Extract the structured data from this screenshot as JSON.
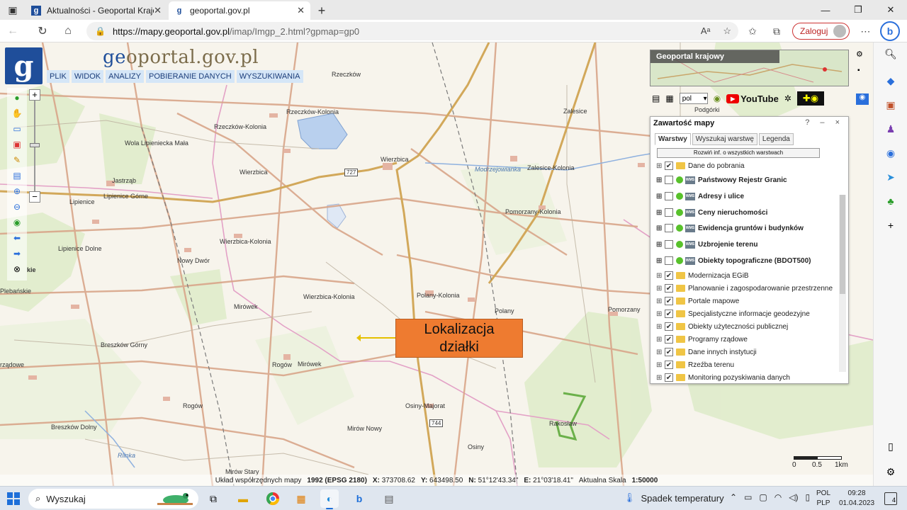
{
  "browser": {
    "tabs": [
      {
        "title": "Aktualności - Geoportal Krajowy",
        "active": false
      },
      {
        "title": "geoportal.gov.pl",
        "active": true
      }
    ],
    "url_host": "https://mapy.geoportal.gov.pl",
    "url_path": "/imap/Imgp_2.html?gpmap=gp0",
    "login_label": "Zaloguj"
  },
  "geoportal": {
    "title_part1": "ge",
    "title_part2": "oportal.gov.pl",
    "logo_letter": "g",
    "menu": [
      "PLIK",
      "WIDOK",
      "ANALIZY",
      "POBIERANIE DANYCH",
      "WYSZUKIWANIA"
    ],
    "minimap_title": "Geoportal krajowy",
    "language": "pol",
    "youtube_label": "YouTube"
  },
  "panel": {
    "title": "Zawartość mapy",
    "controls": "? – ×",
    "tabs": [
      "Warstwy",
      "Wyszukaj warstwę",
      "Legenda"
    ],
    "expand_button": "Rozwiń inf. o wszystkich warstwach",
    "layers": [
      {
        "label": "Dane do pobrania",
        "checked": true,
        "type": "folder",
        "bold": false
      },
      {
        "label": "Państwowy Rejestr Granic",
        "checked": false,
        "type": "wms",
        "bold": true
      },
      {
        "label": "Adresy i ulice",
        "checked": false,
        "type": "wms",
        "bold": true
      },
      {
        "label": "Ceny nieruchomości",
        "checked": false,
        "type": "wms",
        "bold": true
      },
      {
        "label": "Ewidencja gruntów i budynków",
        "checked": false,
        "type": "wms",
        "bold": true
      },
      {
        "label": "Uzbrojenie terenu",
        "checked": false,
        "type": "wms",
        "bold": true
      },
      {
        "label": "Obiekty topograficzne (BDOT500)",
        "checked": false,
        "type": "wms",
        "bold": true
      },
      {
        "label": "Modernizacja EGiB",
        "checked": true,
        "type": "folder",
        "bold": false
      },
      {
        "label": "Planowanie i zagospodarowanie przestrzenne",
        "checked": true,
        "type": "folder",
        "bold": false
      },
      {
        "label": "Portale mapowe",
        "checked": true,
        "type": "folder",
        "bold": false
      },
      {
        "label": "Specjalistyczne informacje geodezyjne",
        "checked": true,
        "type": "folder",
        "bold": false
      },
      {
        "label": "Obiekty użyteczności publicznej",
        "checked": true,
        "type": "folder",
        "bold": false
      },
      {
        "label": "Programy rządowe",
        "checked": true,
        "type": "folder",
        "bold": false
      },
      {
        "label": "Dane innych instytucji",
        "checked": true,
        "type": "folder",
        "bold": false
      },
      {
        "label": "Rzeźba terenu",
        "checked": true,
        "type": "folder",
        "bold": false
      },
      {
        "label": "Monitoring pozyskiwania danych",
        "checked": true,
        "type": "folder",
        "bold": false
      }
    ]
  },
  "callout": {
    "line1": "Lokalizacja",
    "line2": "działki"
  },
  "map_labels": {
    "rzeczkow": "Rzeczków",
    "rzeczkow_kolonia": "Rzeczków-Kolonia",
    "rzeczkow_kolonia2": "Rzeczków-Kolonia",
    "wola_lipieniecka": "Wola Lipieniecka Mała",
    "jastrzab": "Jastrząb",
    "wierzbica": "Wierzbica",
    "wierzbica2": "Wierzbica",
    "lipienice": "Lipienice",
    "lipienice_gorne": "Lipienice Górne",
    "lipienice_dolne": "Lipienice Dolne",
    "wierzbica_kolonia": "Wierzbica-Kolonia",
    "wierzbica_kolonia2": "Wierzbica-Kolonia",
    "nowy_dwor": "Nowy Dwór",
    "mirowek": "Mirówek",
    "mirowek2": "Mirówek",
    "plebanskie": "Plebańskie",
    "breszkow_gorny": "Breszków Górny",
    "breszkow_dolny": "Breszków Dolny",
    "rogow": "Rogów",
    "rogow2": "Rogów",
    "polany_kolonia": "Polany-Kolonia",
    "polany": "Polany",
    "pomorzany_kolonia": "Pomorzany-Kolonia",
    "pomorzany": "Pomorzany",
    "zalesice": "Zalesice",
    "zalesice_kolonia": "Zalesice-Kolonia",
    "modrzejowianka": "Modrzejowianka",
    "osiny_majorat": "Osiny-Majorat",
    "osiny": "Osiny",
    "mirow_nowy": "Mirów Nowy",
    "mirow_stary": "Mirów Stary",
    "rakoslaw": "Rakosław",
    "podgorki": "Podgórki",
    "rzadowe": "rządowe",
    "kie": "kie",
    "rlinka": "Rlinka",
    "road_727": "727",
    "road_744": "744"
  },
  "scalebar": {
    "l0": "0",
    "l1": "0.5",
    "l2": "1km"
  },
  "status": {
    "crs_label": "Układ współrzędnych mapy",
    "crs_value": "1992 (EPSG 2180)",
    "x_label": "X:",
    "x_value": "373708.62",
    "y_label": "Y:",
    "y_value": "643498.50",
    "n_label": "N:",
    "n_value": "51°12'43.34\"",
    "e_label": "E:",
    "e_value": "21°03'18.41\"",
    "scale_label": "Aktualna Skala",
    "scale_value": "1:50000"
  },
  "taskbar": {
    "search_placeholder": "Wyszukaj",
    "weather": "Spadek temperatury",
    "lang_line1": "POL",
    "lang_line2": "PLP",
    "time": "09:28",
    "date": "01.04.2023",
    "notif_count": "4"
  }
}
